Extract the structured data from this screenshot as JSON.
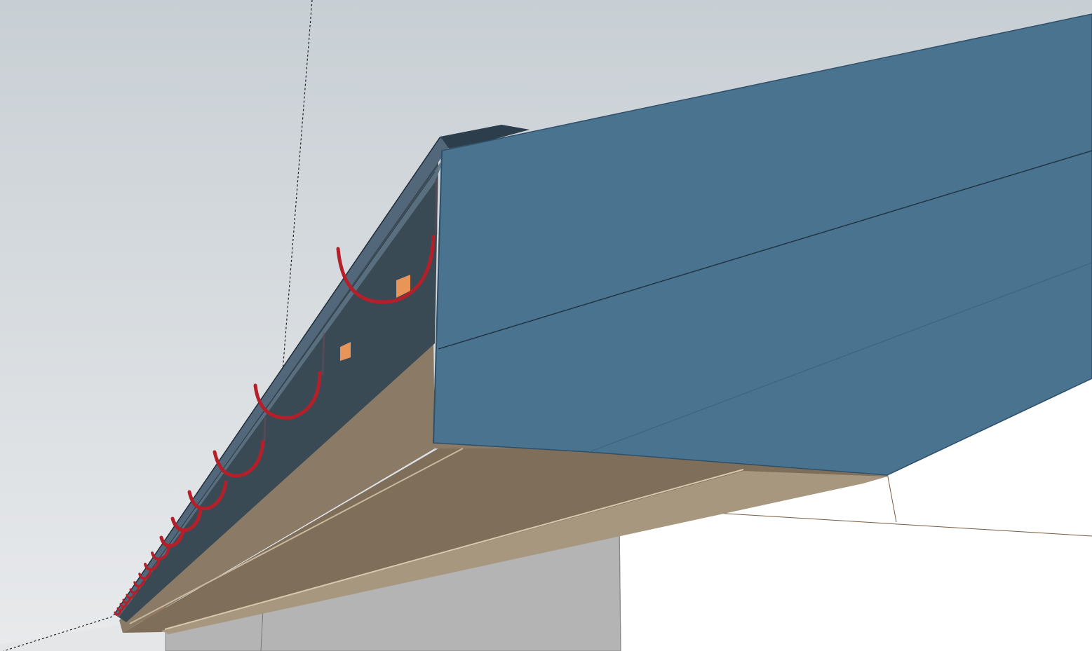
{
  "view": {
    "description_visible_text": "",
    "colors": {
      "sky_top": "#c8cfd4",
      "sky_bottom": "#e6e8ea",
      "ground": "#ffffff",
      "fascia_blue": "#4a7390",
      "fascia_blue_dark": "#3b5f7a",
      "gutter_dark": "#3a4a55",
      "gutter_top": "#52677a",
      "rafter_tan": "#8a7a66",
      "rafter_tan_light": "#a8977f",
      "joist_orange": "#d06a4a",
      "joist_orange_light": "#e9955a",
      "wall_grey": "#b4b4b4",
      "bracket_red": "#b3202a",
      "edge_line": "#1f2d38",
      "guide_line": "#222222"
    }
  }
}
